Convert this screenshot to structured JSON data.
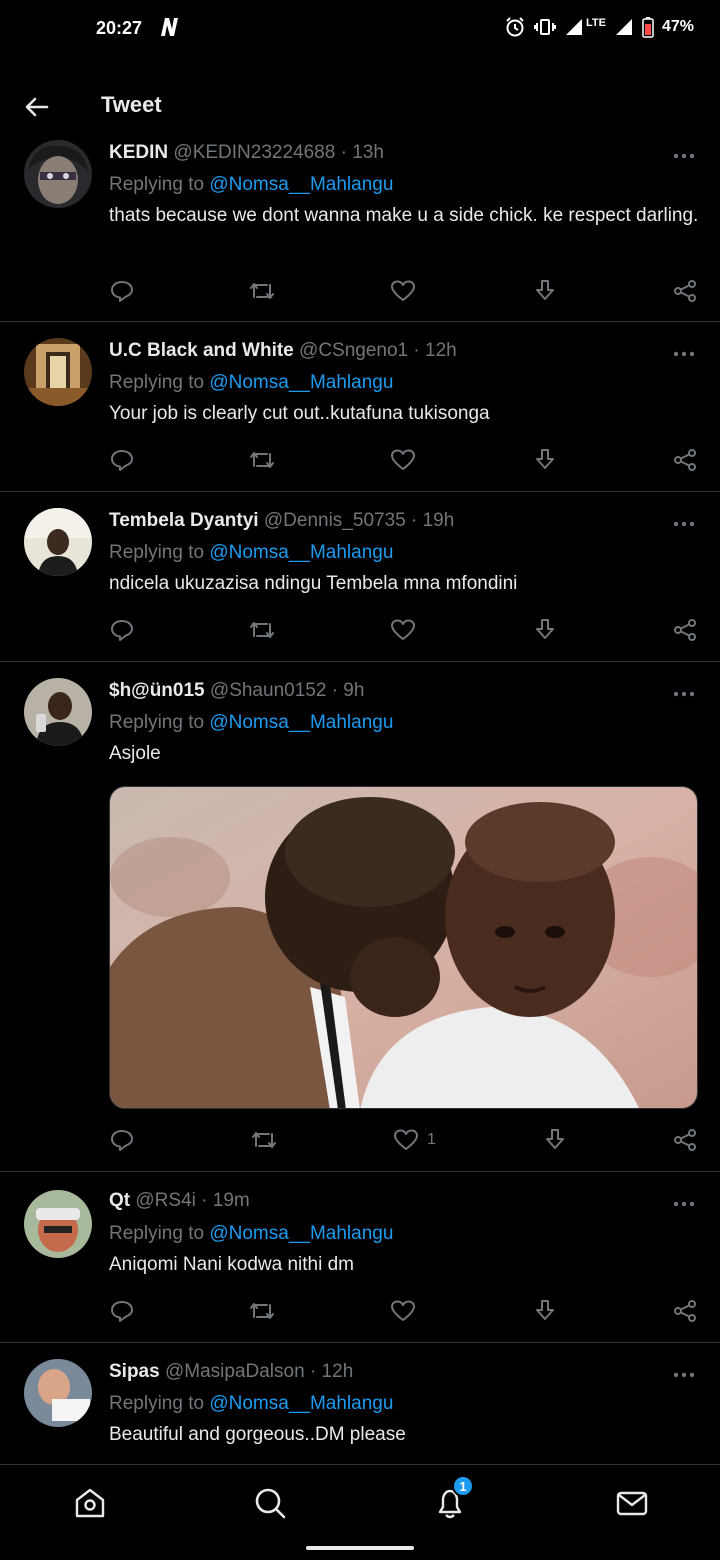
{
  "status_bar": {
    "time": "20:27",
    "network": "LTE",
    "battery": "47%"
  },
  "header": {
    "title": "Tweet"
  },
  "tweets": [
    {
      "name": "KEDIN",
      "handle": "@KEDIN23224688",
      "time": "13h",
      "replying_prefix": "Replying to",
      "replying_to": "@Nomsa__Mahlangu",
      "text": "thats because we dont wanna make u a side chick. ke respect darling."
    },
    {
      "name": "U.C Black and White",
      "handle": "@CSngeno1",
      "time": "12h",
      "replying_prefix": "Replying to",
      "replying_to": "@Nomsa__Mahlangu",
      "text": "Your job is clearly cut out..kutafuna tukisonga"
    },
    {
      "name": "Tembela Dyantyi",
      "handle": "@Dennis_50735",
      "time": "19h",
      "replying_prefix": "Replying to",
      "replying_to": "@Nomsa__Mahlangu",
      "text": "ndicela ukuzazisa ndingu Tembela mna mfondini"
    },
    {
      "name": "$h@ün015",
      "handle": "@Shaun0152",
      "time": "9h",
      "replying_prefix": "Replying to",
      "replying_to": "@Nomsa__Mahlangu",
      "text": "Asjole",
      "like_count": "1"
    },
    {
      "name": "Qt",
      "handle": "@RS4i",
      "time": "19m",
      "replying_prefix": "Replying to",
      "replying_to": "@Nomsa__Mahlangu",
      "text": "Aniqomi Nani kodwa nithi dm"
    },
    {
      "name": "Sipas",
      "handle": "@MasipaDalson",
      "time": "12h",
      "replying_prefix": "Replying to",
      "replying_to": "@Nomsa__Mahlangu",
      "text": "Beautiful and gorgeous..DM please"
    }
  ],
  "bottom_nav": {
    "notifications_badge": "1"
  },
  "icons": {
    "back": "arrow-left-icon",
    "more": "more-dots-icon",
    "reply": "reply-icon",
    "retweet": "retweet-icon",
    "like": "heart-icon",
    "download": "download-icon",
    "share": "share-icon",
    "home": "home-icon",
    "search": "search-icon",
    "notifications": "bell-icon",
    "messages": "mail-icon"
  },
  "colors": {
    "background": "#000000",
    "text": "#e7e9ea",
    "muted": "#71767b",
    "accent": "#1d9bf0",
    "divider": "#2f3336"
  }
}
